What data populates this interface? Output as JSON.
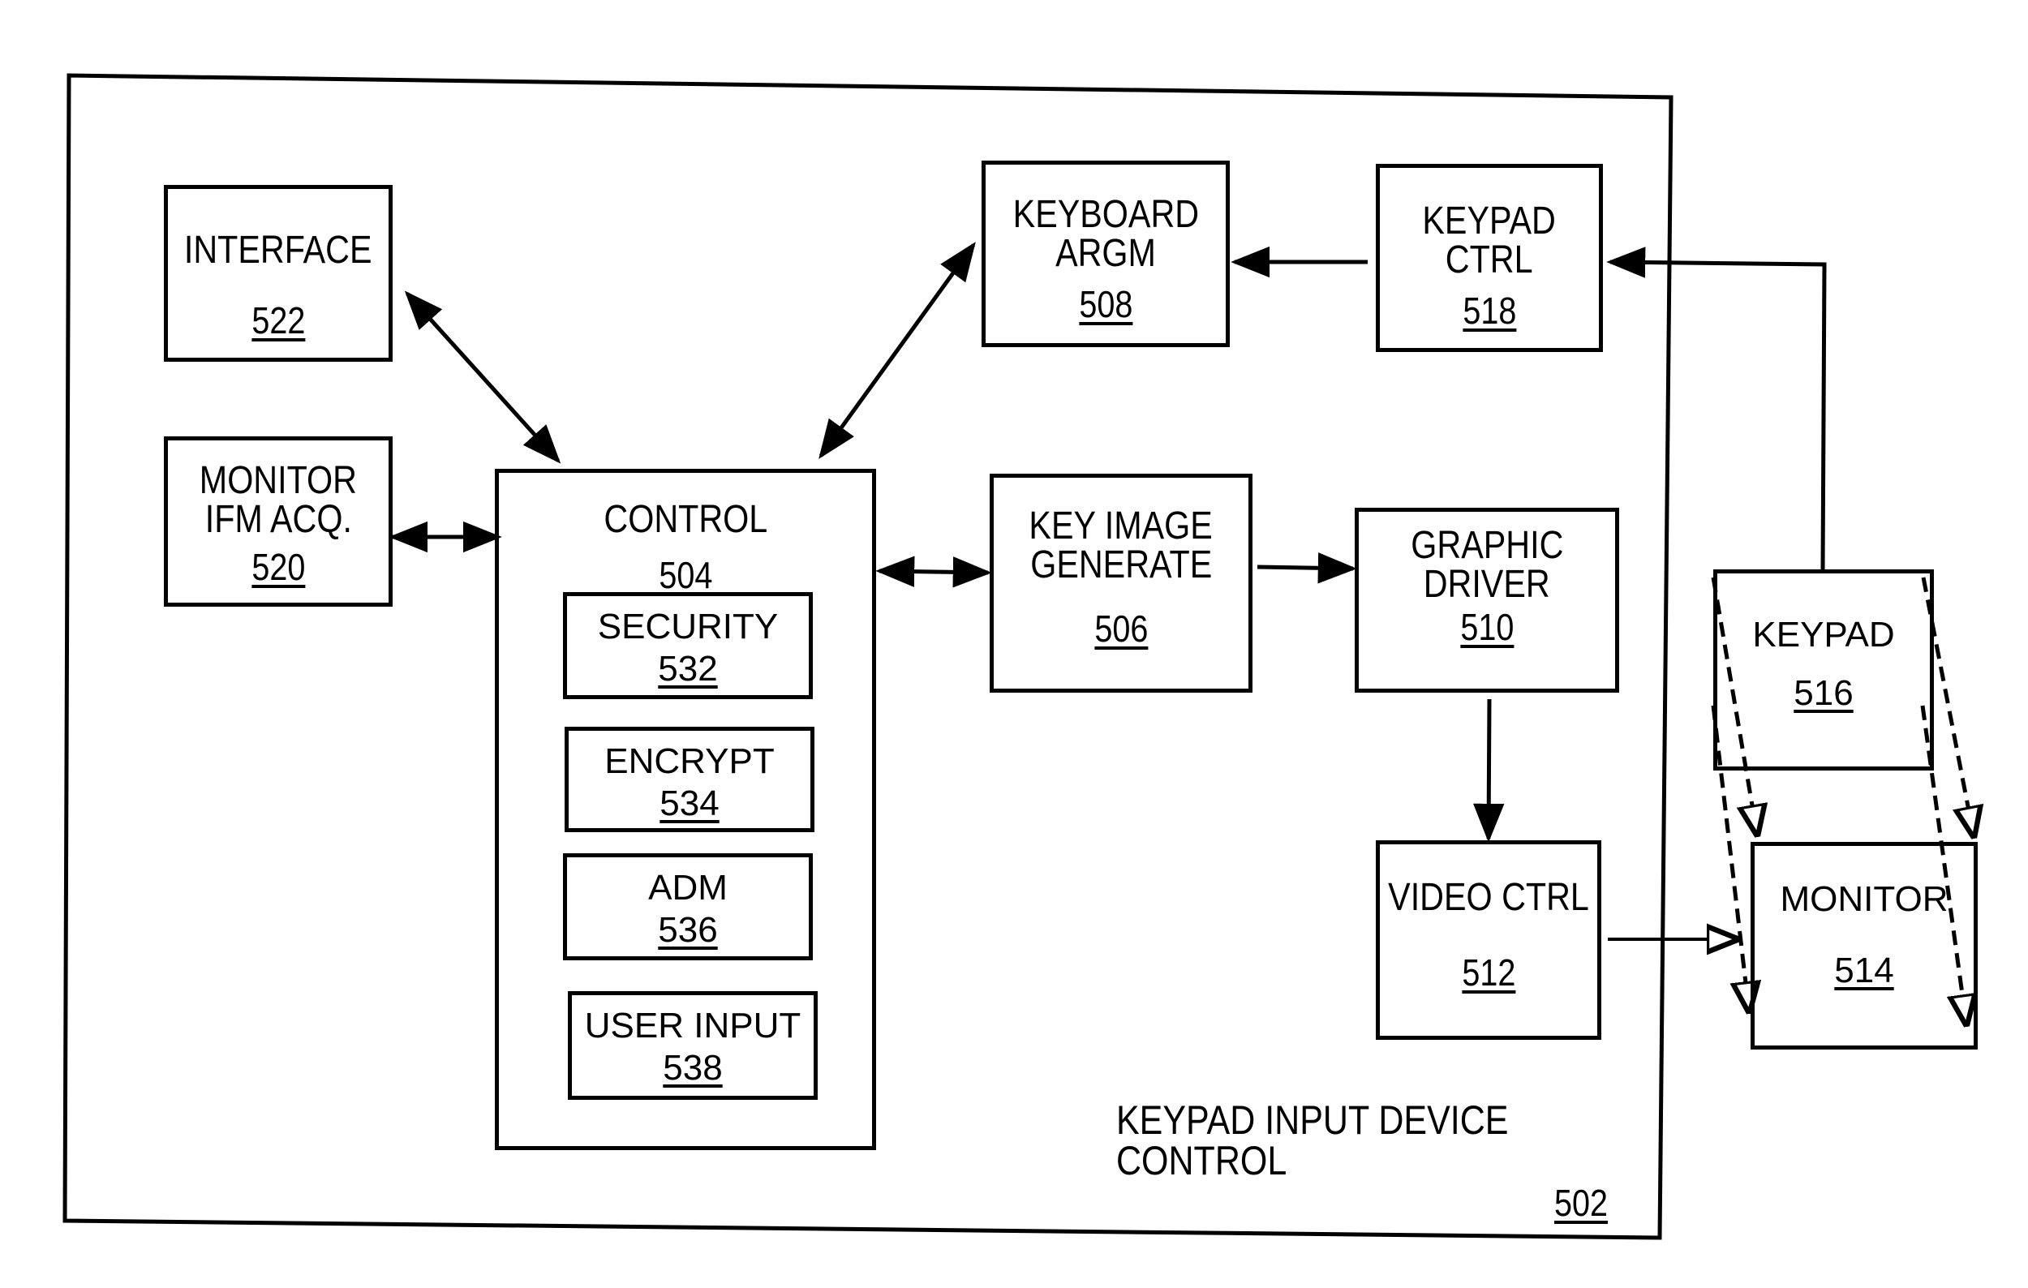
{
  "figure": {
    "outer": {
      "caption_line1": "KEYPAD INPUT DEVICE",
      "caption_line2": "CONTROL",
      "ref": "502"
    },
    "blocks": {
      "interface": {
        "label": "INTERFACE",
        "ref": "522"
      },
      "monitor_ifm": {
        "label_line1": "MONITOR",
        "label_line2": "IFM ACQ.",
        "ref": "520"
      },
      "control": {
        "label": "CONTROL",
        "ref": "504"
      },
      "security": {
        "label": "SECURITY",
        "ref": "532"
      },
      "encrypt": {
        "label": "ENCRYPT",
        "ref": "534"
      },
      "adm": {
        "label": "ADM",
        "ref": "536"
      },
      "user_input": {
        "label": "USER INPUT",
        "ref": "538"
      },
      "keyboard_argm": {
        "label_line1": "KEYBOARD",
        "label_line2": "ARGM",
        "ref": "508"
      },
      "keypad_ctrl": {
        "label_line1": "KEYPAD",
        "label_line2": "CTRL",
        "ref": "518"
      },
      "key_image": {
        "label_line1": "KEY IMAGE",
        "label_line2": "GENERATE",
        "ref": "506"
      },
      "graphic_driver": {
        "label_line1": "GRAPHIC",
        "label_line2": "DRIVER",
        "ref": "510"
      },
      "video_ctrl": {
        "label": "VIDEO CTRL",
        "ref": "512"
      },
      "keypad": {
        "label": "KEYPAD",
        "ref": "516"
      },
      "monitor": {
        "label": "MONITOR",
        "ref": "514"
      }
    },
    "connections": [
      {
        "from": "interface",
        "to": "control",
        "type": "bidirectional"
      },
      {
        "from": "monitor_ifm",
        "to": "control",
        "type": "bidirectional"
      },
      {
        "from": "control",
        "to": "keyboard_argm",
        "type": "bidirectional"
      },
      {
        "from": "control",
        "to": "key_image",
        "type": "bidirectional"
      },
      {
        "from": "keypad_ctrl",
        "to": "keyboard_argm",
        "type": "directed"
      },
      {
        "from": "keypad",
        "to": "keypad_ctrl",
        "type": "directed"
      },
      {
        "from": "key_image",
        "to": "graphic_driver",
        "type": "directed"
      },
      {
        "from": "graphic_driver",
        "to": "video_ctrl",
        "type": "directed"
      },
      {
        "from": "video_ctrl",
        "to": "monitor",
        "type": "directed"
      },
      {
        "from": "keypad",
        "to": "monitor",
        "type": "dashed-projection"
      }
    ]
  }
}
